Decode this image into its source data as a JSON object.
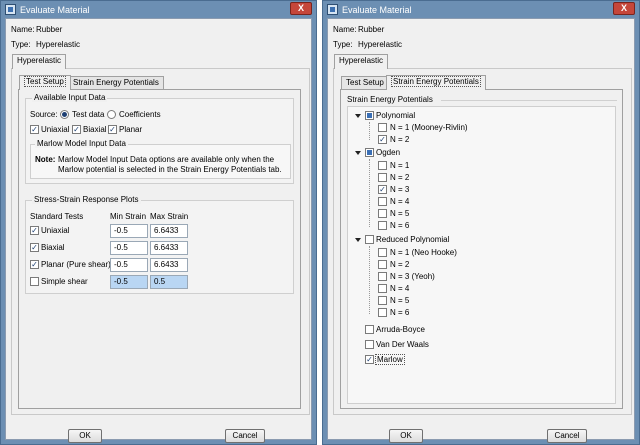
{
  "left_window": {
    "title": "Evaluate Material",
    "close_label": "X",
    "name_label": "Name:",
    "name_value": "Rubber",
    "type_label": "Type:",
    "type_value": "Hyperelastic",
    "outer_tab": "Hyperelastic",
    "tabs": [
      "Test Setup",
      "Strain Energy Potentials"
    ],
    "available_input": {
      "title": "Available Input Data",
      "source_label": "Source:",
      "source_options": [
        "Test data",
        "Coefficients"
      ],
      "source_selected": "Test data",
      "test_types": [
        {
          "label": "Uniaxial",
          "checked": true
        },
        {
          "label": "Biaxial",
          "checked": true
        },
        {
          "label": "Planar",
          "checked": true
        }
      ],
      "marlow_title": "Marlow Model Input Data",
      "note_label": "Note:",
      "note_line1": "Marlow Model Input Data options are available only when the",
      "note_line2": "Marlow potential is selected in the Strain Energy Potentials tab."
    },
    "response_plots": {
      "title": "Stress-Strain Response Plots",
      "headers": [
        "Standard Tests",
        "Min Strain",
        "Max Strain"
      ],
      "rows": [
        {
          "label": "Uniaxial",
          "checked": true,
          "min": "-0.5",
          "max": "6.6433"
        },
        {
          "label": "Biaxial",
          "checked": true,
          "min": "-0.5",
          "max": "6.6433"
        },
        {
          "label": "Planar (Pure shear)",
          "checked": true,
          "min": "-0.5",
          "max": "6.6433"
        },
        {
          "label": "Simple shear",
          "checked": false,
          "min": "-0.5",
          "max": "0.5"
        }
      ]
    },
    "ok_label": "OK",
    "cancel_label": "Cancel"
  },
  "right_window": {
    "title": "Evaluate Material",
    "close_label": "X",
    "name_label": "Name:",
    "name_value": "Rubber",
    "type_label": "Type:",
    "type_value": "Hyperelastic",
    "outer_tab": "Hyperelastic",
    "tabs": [
      "Test Setup",
      "Strain Energy Potentials"
    ],
    "sep_title": "Strain Energy Potentials",
    "tree": {
      "polynomial": {
        "label": "Polynomial",
        "children": [
          {
            "label": "N = 1 (Mooney-Rivlin)",
            "checked": false
          },
          {
            "label": "N = 2",
            "checked": true
          }
        ]
      },
      "ogden": {
        "label": "Ogden",
        "children": [
          {
            "label": "N = 1",
            "checked": false
          },
          {
            "label": "N = 2",
            "checked": false
          },
          {
            "label": "N = 3",
            "checked": true
          },
          {
            "label": "N = 4",
            "checked": false
          },
          {
            "label": "N = 5",
            "checked": false
          },
          {
            "label": "N = 6",
            "checked": false
          }
        ]
      },
      "reduced_polynomial": {
        "label": "Reduced Polynomial",
        "children": [
          {
            "label": "N = 1 (Neo Hooke)",
            "checked": false
          },
          {
            "label": "N = 2",
            "checked": false
          },
          {
            "label": "N = 3 (Yeoh)",
            "checked": false
          },
          {
            "label": "N = 4",
            "checked": false
          },
          {
            "label": "N = 5",
            "checked": false
          },
          {
            "label": "N = 6",
            "checked": false
          }
        ]
      },
      "arruda_boyce": {
        "label": "Arruda-Boyce",
        "checked": false
      },
      "van_der_waals": {
        "label": "Van Der Waals",
        "checked": false
      },
      "marlow": {
        "label": "Marlow",
        "checked": true
      }
    },
    "ok_label": "OK",
    "cancel_label": "Cancel"
  },
  "colors": {
    "title_bar": "#6c8fb3",
    "close_button": "#c5463a",
    "highlight_field": "#b9d6f3",
    "checkmark": "#1d3f73"
  }
}
